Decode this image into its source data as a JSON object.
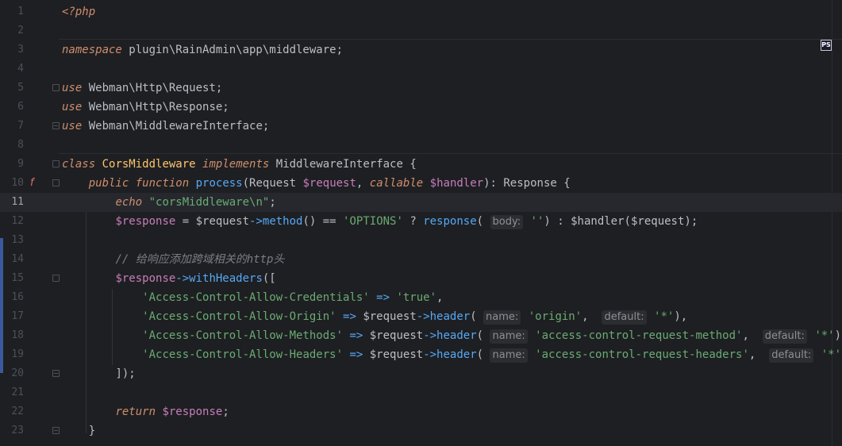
{
  "editor": {
    "badge": "PS",
    "current_line": 11,
    "line_numbers": [
      "1",
      "2",
      "3",
      "4",
      "5",
      "6",
      "7",
      "8",
      "9",
      "10",
      "11",
      "12",
      "13",
      "14",
      "15",
      "16",
      "17",
      "18",
      "19",
      "20",
      "21",
      "22",
      "23"
    ],
    "lines": {
      "l1": [
        "<?php"
      ],
      "l3": [
        "namespace",
        " plugin\\RainAdmin\\app\\middleware;"
      ],
      "l5": [
        "use",
        " Webman\\Http\\Request;"
      ],
      "l6": [
        "use",
        " Webman\\Http\\Response;"
      ],
      "l7": [
        "use",
        " Webman\\MiddlewareInterface;"
      ],
      "l9": [
        "class",
        " ",
        "CorsMiddleware",
        " ",
        "implements",
        " MiddlewareInterface {"
      ],
      "l10": [
        "    ",
        "public",
        " ",
        "function",
        " ",
        "process",
        "(Request ",
        "$request",
        ", ",
        "callable",
        " ",
        "$handler",
        "): Response {"
      ],
      "l11": [
        "        ",
        "echo",
        " ",
        "\"corsMiddleware\\n\"",
        ";"
      ],
      "l12": [
        "        ",
        "$response",
        " = ",
        "$request",
        "->",
        "method",
        "() == ",
        "'OPTIONS'",
        " ? ",
        "response",
        "( ",
        "body:",
        " ",
        "''",
        ") : ",
        "$handler",
        "(",
        "$request",
        ");"
      ],
      "l14": [
        "        ",
        "// 给响应添加跨域相关的http头"
      ],
      "l15": [
        "        ",
        "$response",
        "->",
        "withHeaders",
        "(["
      ],
      "l16": [
        "            ",
        "'Access-Control-Allow-Credentials'",
        " => ",
        "'true'",
        ","
      ],
      "l17": [
        "            ",
        "'Access-Control-Allow-Origin'",
        " => ",
        "$request",
        "->",
        "header",
        "( ",
        "name:",
        " ",
        "'origin'",
        ",  ",
        "default:",
        " ",
        "'*'",
        "),"
      ],
      "l18": [
        "            ",
        "'Access-Control-Allow-Methods'",
        " => ",
        "$request",
        "->",
        "header",
        "( ",
        "name:",
        " ",
        "'access-control-request-method'",
        ",  ",
        "default:",
        " ",
        "'*'",
        "),"
      ],
      "l19": [
        "            ",
        "'Access-Control-Allow-Headers'",
        " => ",
        "$request",
        "->",
        "header",
        "( ",
        "name:",
        " ",
        "'access-control-request-headers'",
        ",  ",
        "default:",
        " ",
        "'*'",
        "),"
      ],
      "l20": [
        "        ",
        "]);"
      ],
      "l22": [
        "        ",
        "return",
        " ",
        "$response",
        ";"
      ],
      "l23": [
        "    ",
        "}"
      ]
    }
  }
}
